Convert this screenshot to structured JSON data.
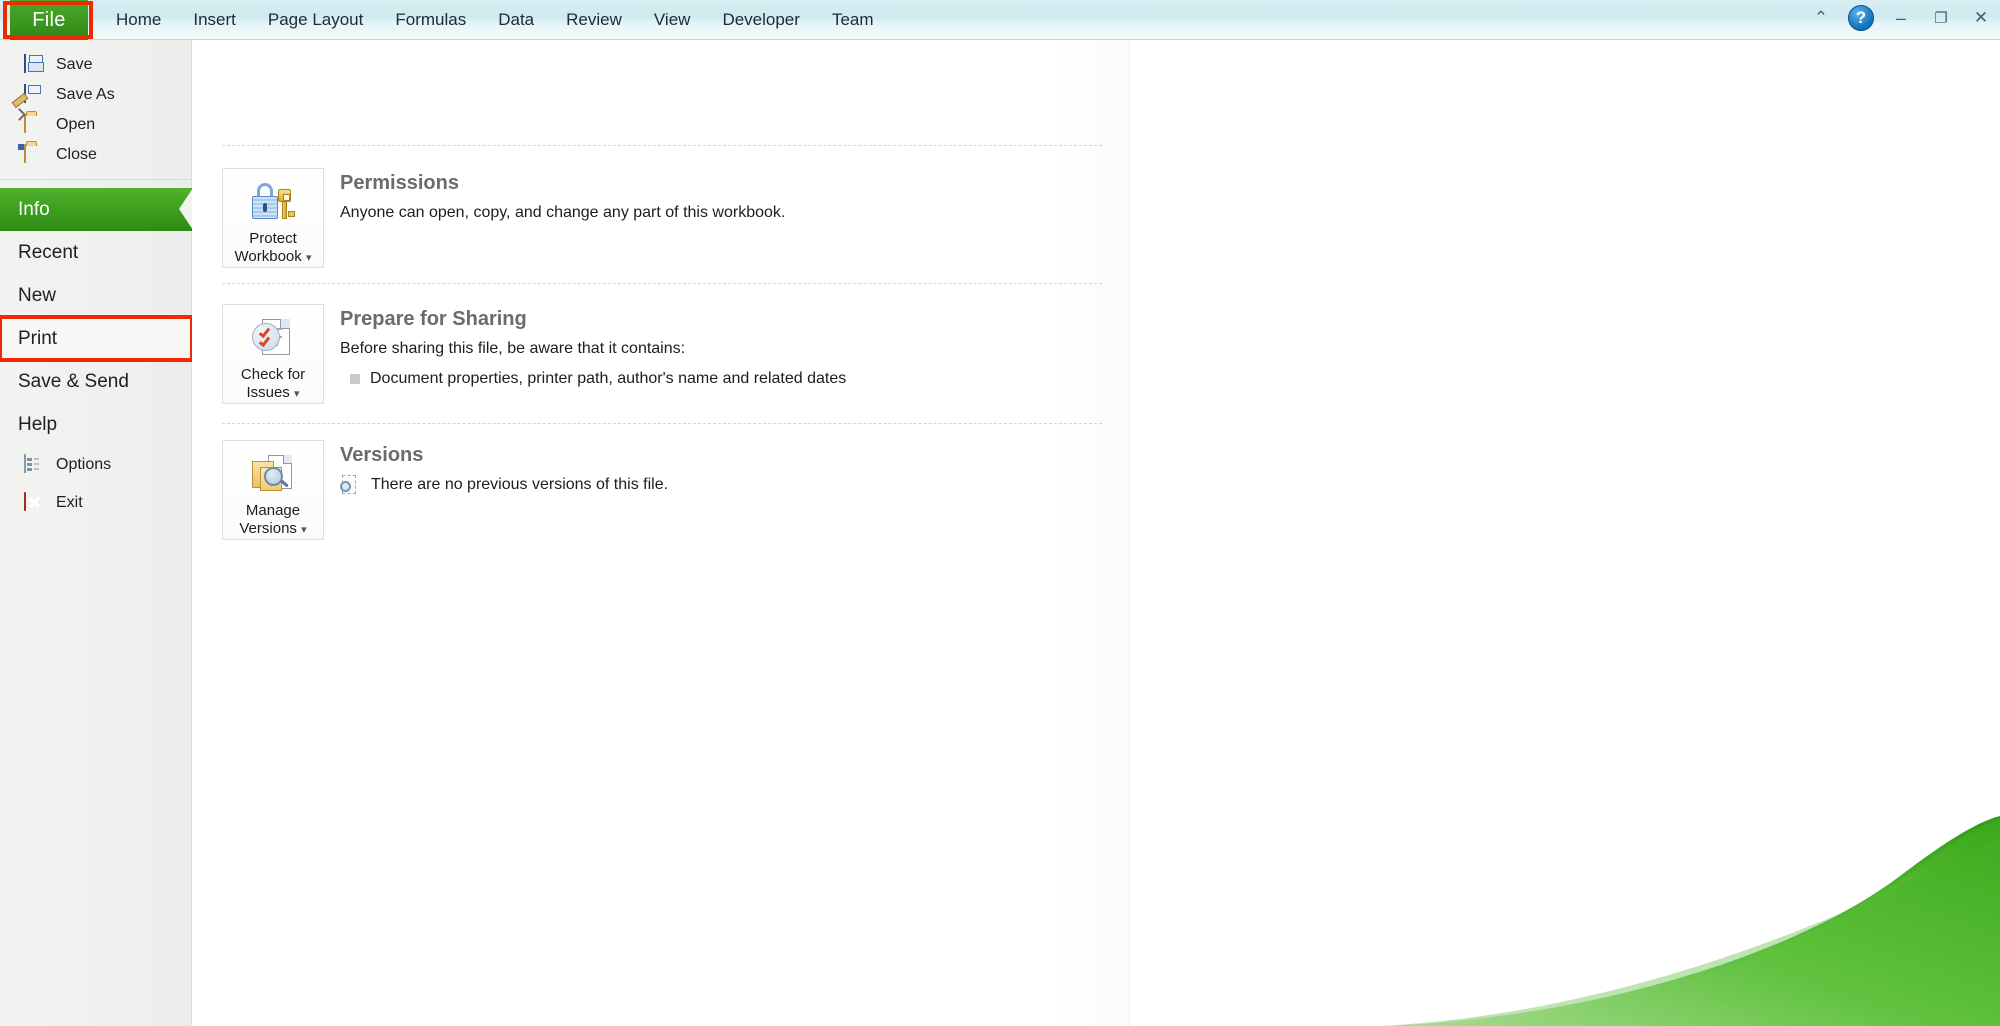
{
  "window": {
    "controls": [
      {
        "name": "minimize-ribbon-icon",
        "glyph": "⌃"
      },
      {
        "name": "help-icon",
        "glyph": "?"
      },
      {
        "name": "minimize-window-icon",
        "glyph": "–"
      },
      {
        "name": "restore-window-icon",
        "glyph": "❐"
      },
      {
        "name": "close-window-icon",
        "glyph": "✕"
      }
    ]
  },
  "ribbon": {
    "file_tab": "File",
    "tabs": [
      "Home",
      "Insert",
      "Page Layout",
      "Formulas",
      "Data",
      "Review",
      "View",
      "Developer",
      "Team"
    ]
  },
  "sidebar": {
    "commands": [
      {
        "label": "Save",
        "icon": "save-icon"
      },
      {
        "label": "Save As",
        "icon": "save-as-icon"
      },
      {
        "label": "Open",
        "icon": "open-folder-icon"
      },
      {
        "label": "Close",
        "icon": "close-folder-icon"
      }
    ],
    "nav": [
      {
        "label": "Info",
        "state": "active"
      },
      {
        "label": "Recent",
        "state": "normal"
      },
      {
        "label": "New",
        "state": "normal"
      },
      {
        "label": "Print",
        "state": "highlighted"
      },
      {
        "label": "Save & Send",
        "state": "normal"
      },
      {
        "label": "Help",
        "state": "heading"
      }
    ],
    "footer": [
      {
        "label": "Options",
        "icon": "options-icon"
      },
      {
        "label": "Exit",
        "icon": "exit-icon"
      }
    ]
  },
  "info": {
    "permissions": {
      "title": "Permissions",
      "description": "Anyone can open, copy, and change any part of this workbook.",
      "button_line1": "Protect",
      "button_line2": "Workbook",
      "button_caret": "▾"
    },
    "prepare": {
      "title": "Prepare for Sharing",
      "description": "Before sharing this file, be aware that it contains:",
      "bullet": "Document properties, printer path, author's name and related dates",
      "button_line1": "Check for",
      "button_line2": "Issues",
      "button_caret": "▾"
    },
    "versions": {
      "title": "Versions",
      "description": "There are no previous versions of this file.",
      "button_line1": "Manage",
      "button_line2": "Versions",
      "button_caret": "▾"
    }
  },
  "colors": {
    "accent_green": "#3f9f1f",
    "highlight_red": "#f02a00",
    "title_gray": "#6b6b6b"
  }
}
